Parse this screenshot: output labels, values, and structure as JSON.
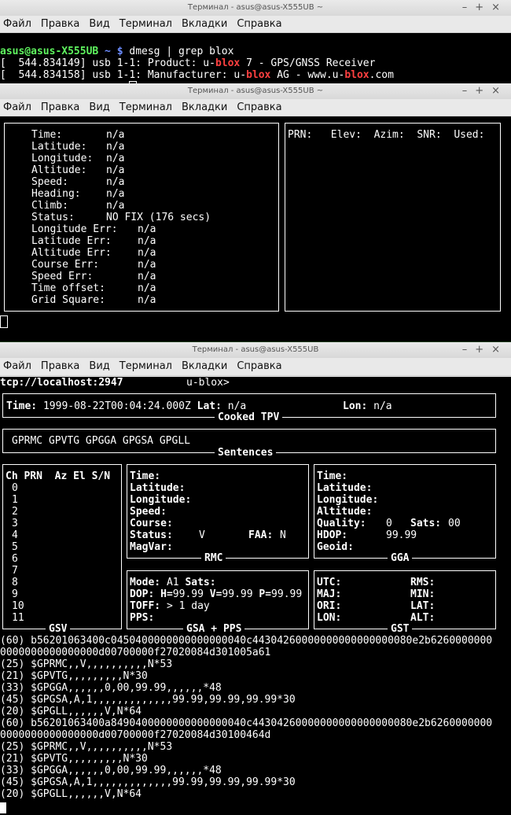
{
  "menu": [
    "Файл",
    "Правка",
    "Вид",
    "Терминал",
    "Вкладки",
    "Справка"
  ],
  "win1": {
    "title": "Терминал - asus@asus-X555UB ~",
    "prompt": "asus@asus-X555UB",
    "sep": " ~ $ ",
    "cmd": "dmesg | grep blox",
    "l1a": "[  544.834149] usb 1-1: Product: u-",
    "l1hl": "blox",
    "l1b": " 7 - GPS/GNSS Receiver",
    "l2a": "[  544.834158] usb 1-1: Manufacturer: u-",
    "l2hl": "blox",
    "l2b": " AG - www.u-",
    "l2hl2": "blox",
    "l2c": ".com"
  },
  "win2": {
    "title": "Терминал - asus@asus-X555UB ~",
    "fix": [
      {
        "k": "Time:",
        "v": "n/a"
      },
      {
        "k": "Latitude:",
        "v": "n/a"
      },
      {
        "k": "Longitude:",
        "v": "n/a"
      },
      {
        "k": "Altitude:",
        "v": "n/a"
      },
      {
        "k": "Speed:",
        "v": "n/a"
      },
      {
        "k": "Heading:",
        "v": "n/a"
      },
      {
        "k": "Climb:",
        "v": "n/a"
      },
      {
        "k": "Status:",
        "v": "NO FIX (176 secs)"
      }
    ],
    "err": [
      {
        "k": "Longitude Err:",
        "v": "n/a"
      },
      {
        "k": "Latitude Err:",
        "v": "n/a"
      },
      {
        "k": "Altitude Err:",
        "v": "n/a"
      },
      {
        "k": "Course Err:",
        "v": "n/a"
      },
      {
        "k": "Speed Err:",
        "v": "n/a"
      },
      {
        "k": "Time offset:",
        "v": "n/a"
      },
      {
        "k": "Grid Square:",
        "v": "n/a"
      }
    ],
    "sat_headers": "PRN:   Elev:  Azim:  SNR:  Used:"
  },
  "win3": {
    "title": "Терминал - asus@asus-X555UB",
    "host": "tcp://localhost:2947",
    "device": "u-blox>",
    "tpv_time_label": "Time:",
    "tpv_time": "1999-08-22T00:04:24.000Z",
    "tpv_lat_label": "Lat:",
    "tpv_lat": "n/a",
    "tpv_lon_label": "Lon:",
    "tpv_lon": "n/a",
    "cap_tpv": "Cooked TPV",
    "sentences": "GPRMC GPVTG GPGGA GPGSA GPGLL",
    "cap_sentences": "Sentences",
    "gsv_header": "Ch PRN  Az El S/N",
    "gsv_channels": [
      "0",
      "1",
      "2",
      "3",
      "4",
      "5",
      "6",
      "7",
      "8",
      "9",
      "10",
      "11"
    ],
    "cap_gsv": "GSV",
    "rmc": [
      "Time:",
      "Latitude:",
      "Longitude:",
      "Speed:",
      "Course:"
    ],
    "rmc_status_label": "Status:",
    "rmc_status": "V",
    "rmc_faa_label": "FAA:",
    "rmc_faa": "N",
    "rmc_magvar": "MagVar:",
    "cap_rmc": "RMC",
    "gga": [
      "Time:",
      "Latitude:",
      "Longitude:",
      "Altitude:"
    ],
    "gga_quality_label": "Quality:",
    "gga_quality": "0",
    "gga_sats_label": "Sats:",
    "gga_sats": "00",
    "gga_hdop_label": "HDOP:",
    "gga_hdop": "99.99",
    "gga_geoid": "Geoid:",
    "cap_gga": "GGA",
    "gsa_mode_label": "Mode:",
    "gsa_mode": "A1",
    "gsa_sats_label": "Sats:",
    "gsa_dop_label": "DOP:",
    "gsa_h_label": "H=",
    "gsa_h": "99.99",
    "gsa_v_label": "V=",
    "gsa_v": "99.99",
    "gsa_p_label": "P=",
    "gsa_p": "99.99",
    "gsa_toff_label": "TOFF:",
    "gsa_toff": "> 1 day",
    "gsa_pps_label": "PPS:",
    "cap_gsa": "GSA + PPS",
    "gst_left": [
      "UTC:",
      "MAJ:",
      "ORI:",
      "LON:"
    ],
    "gst_right": [
      "RMS:",
      "MIN:",
      "LAT:",
      "ALT:"
    ],
    "cap_gst": "GST",
    "log": [
      "(60) b56201063400c0450400000000000000040c44304260000000000000000080e2b6260000000",
      "0000000000000000d00700000f27020084d301005a61",
      "(25) $GPRMC,,V,,,,,,,,,,N*53",
      "(21) $GPVTG,,,,,,,,,N*30",
      "(33) $GPGGA,,,,,,0,00,99.99,,,,,,*48",
      "(45) $GPGSA,A,1,,,,,,,,,,,,,99.99,99.99,99.99*30",
      "(20) $GPGLL,,,,,,V,N*64",
      "(60) b56201063400a8490400000000000000040c44304260000000000000000080e2b6260000000",
      "0000000000000000d00700000f27020084d30100464d",
      "(25) $GPRMC,,V,,,,,,,,,,N*53",
      "(21) $GPVTG,,,,,,,,,N*30",
      "(33) $GPGGA,,,,,,0,00,99.99,,,,,,*48",
      "(45) $GPGSA,A,1,,,,,,,,,,,,,99.99,99.99,99.99*30",
      "(20) $GPGLL,,,,,,V,N*64"
    ]
  }
}
